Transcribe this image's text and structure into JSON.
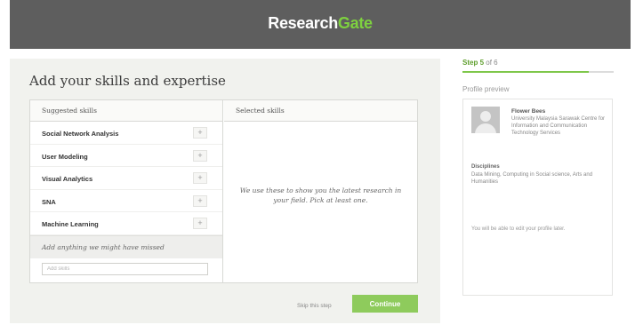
{
  "header": {
    "logo_primary": "Research",
    "logo_accent": "Gate"
  },
  "main": {
    "title": "Add your skills and expertise",
    "suggested_heading": "Suggested skills",
    "selected_heading": "Selected skills",
    "skills": [
      {
        "label": "Social Network Analysis",
        "add": "+"
      },
      {
        "label": "User Modeling",
        "add": "+"
      },
      {
        "label": "Visual Analytics",
        "add": "+"
      },
      {
        "label": "SNA",
        "add": "+"
      },
      {
        "label": "Machine Learning",
        "add": "+"
      }
    ],
    "missed_text": "Add anything we might have missed",
    "add_placeholder": "Add skills",
    "selected_hint": "We use these to show you the latest research in your field. Pick at least one.",
    "skip_label": "Skip this step",
    "continue_label": "Continue"
  },
  "sidebar": {
    "step_prefix": "Step",
    "step_current": "5",
    "step_suffix": "of 6",
    "progress_fraction": 0.833,
    "preview_title": "Profile preview",
    "profile": {
      "name": "Flower Bees",
      "affiliation": "University Malaysia Sarawak Centre for Information and Communication Technology Services",
      "disciplines_label": "Disciplines",
      "disciplines": "Data Mining, Computing in Social science, Arts and Humanities",
      "edit_note": "You will be able to edit your profile later."
    }
  },
  "colors": {
    "brand_green": "#7ed13f",
    "header_gray": "#5e5e5e",
    "continue_green": "#8ecb5c"
  },
  "icons": {
    "add": "plus-icon",
    "avatar": "user-silhouette-icon"
  }
}
